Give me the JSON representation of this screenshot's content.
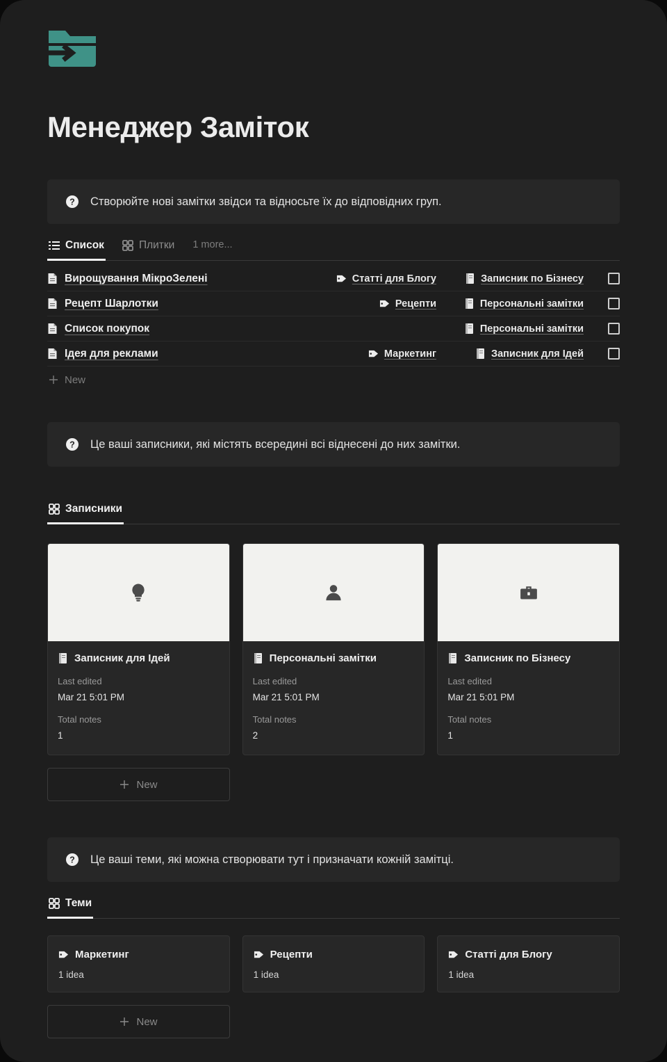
{
  "app": {
    "logo_icon": "folder-arrow-icon",
    "accent_color": "#3f9287",
    "title": "Менеджер Заміток"
  },
  "notes_section": {
    "banner": {
      "icon": "question-circle-icon",
      "text": "Створюйте нові замітки звідси та відносьте їх до відповідних груп."
    },
    "tabs": [
      {
        "label": "Список",
        "icon": "list-icon",
        "active": true
      },
      {
        "label": "Плитки",
        "icon": "grid-icon",
        "active": false
      },
      {
        "label": "1 more...",
        "icon": "",
        "active": false
      }
    ],
    "rows": [
      {
        "icon": "document-icon",
        "title": "Вирощування МікроЗелені",
        "tag": "Статті для Блогу",
        "notebook": "Записник по Бізнесу",
        "checked": false
      },
      {
        "icon": "document-icon",
        "title": "Рецепт Шарлотки",
        "tag": "Рецепти",
        "notebook": "Персональні замітки",
        "checked": false
      },
      {
        "icon": "document-icon",
        "title": "Список покупок",
        "tag": "",
        "notebook": "Персональні замітки",
        "checked": false
      },
      {
        "icon": "document-icon",
        "title": "Ідея для реклами",
        "tag": "Маркетинг",
        "notebook": "Записник для Ідей",
        "checked": false
      }
    ],
    "new_label": "New"
  },
  "notebooks_section": {
    "banner": {
      "icon": "question-circle-icon",
      "text": "Це ваші записники, які містять всередині всі віднесені до них замітки."
    },
    "header": {
      "label": "Записники",
      "icon": "grid-icon"
    },
    "labels": {
      "last_edited": "Last edited",
      "total_notes": "Total notes"
    },
    "cards": [
      {
        "thumb_icon": "lightbulb-icon",
        "title": "Записник для Ідей",
        "last_edited": "Mar 21 5:01 PM",
        "total_notes": "1"
      },
      {
        "thumb_icon": "person-icon",
        "title": "Персональні замітки",
        "last_edited": "Mar 21 5:01 PM",
        "total_notes": "2"
      },
      {
        "thumb_icon": "briefcase-icon",
        "title": "Записник по Бізнесу",
        "last_edited": "Mar 21 5:01 PM",
        "total_notes": "1"
      }
    ],
    "new_label": "New"
  },
  "themes_section": {
    "banner": {
      "icon": "question-circle-icon",
      "text": "Це ваші теми, які можна створювати тут і призначати кожній замітці."
    },
    "header": {
      "label": "Теми",
      "icon": "grid-icon"
    },
    "cards": [
      {
        "title": "Маркетинг",
        "count": "1 idea"
      },
      {
        "title": "Рецепти",
        "count": "1 idea"
      },
      {
        "title": "Статті для Блогу",
        "count": "1 idea"
      }
    ],
    "new_label": "New"
  }
}
